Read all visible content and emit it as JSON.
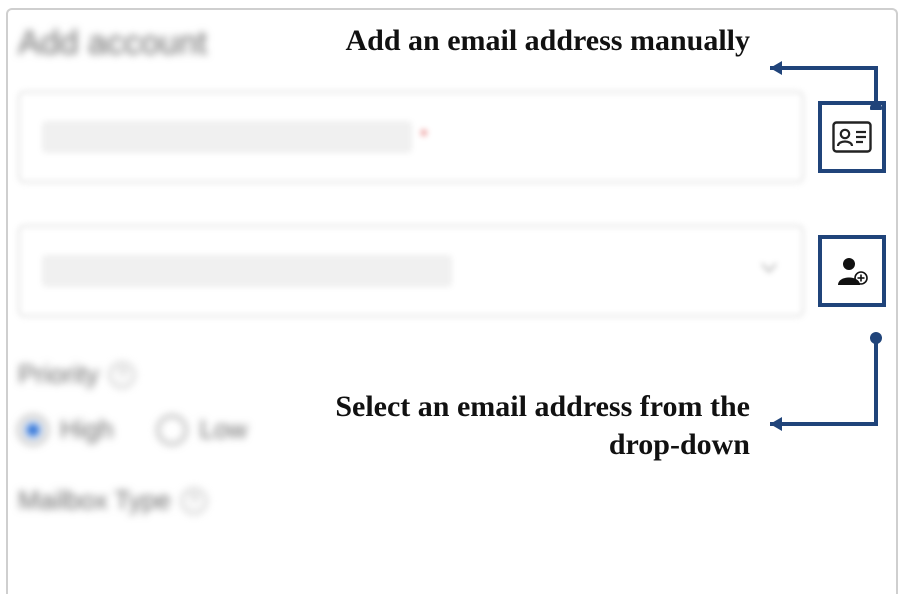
{
  "page": {
    "title": "Add account"
  },
  "fields": {
    "email": {
      "required_marker": "*"
    },
    "dropdown": {}
  },
  "buttons": {
    "manual_email": {
      "name": "add-email-manual-button"
    },
    "dropdown_email": {
      "name": "select-email-dropdown-button"
    }
  },
  "priority": {
    "label": "Priority",
    "help": "?",
    "options": {
      "high": "High",
      "low": "Low"
    },
    "selected": "high"
  },
  "mailbox": {
    "label": "Mailbox Type",
    "help": "?"
  },
  "annotations": {
    "manual": "Add an email address manually",
    "dropdown": "Select an email address from the drop-down"
  },
  "colors": {
    "accent": "#20447a",
    "radio": "#2a6fd6"
  }
}
